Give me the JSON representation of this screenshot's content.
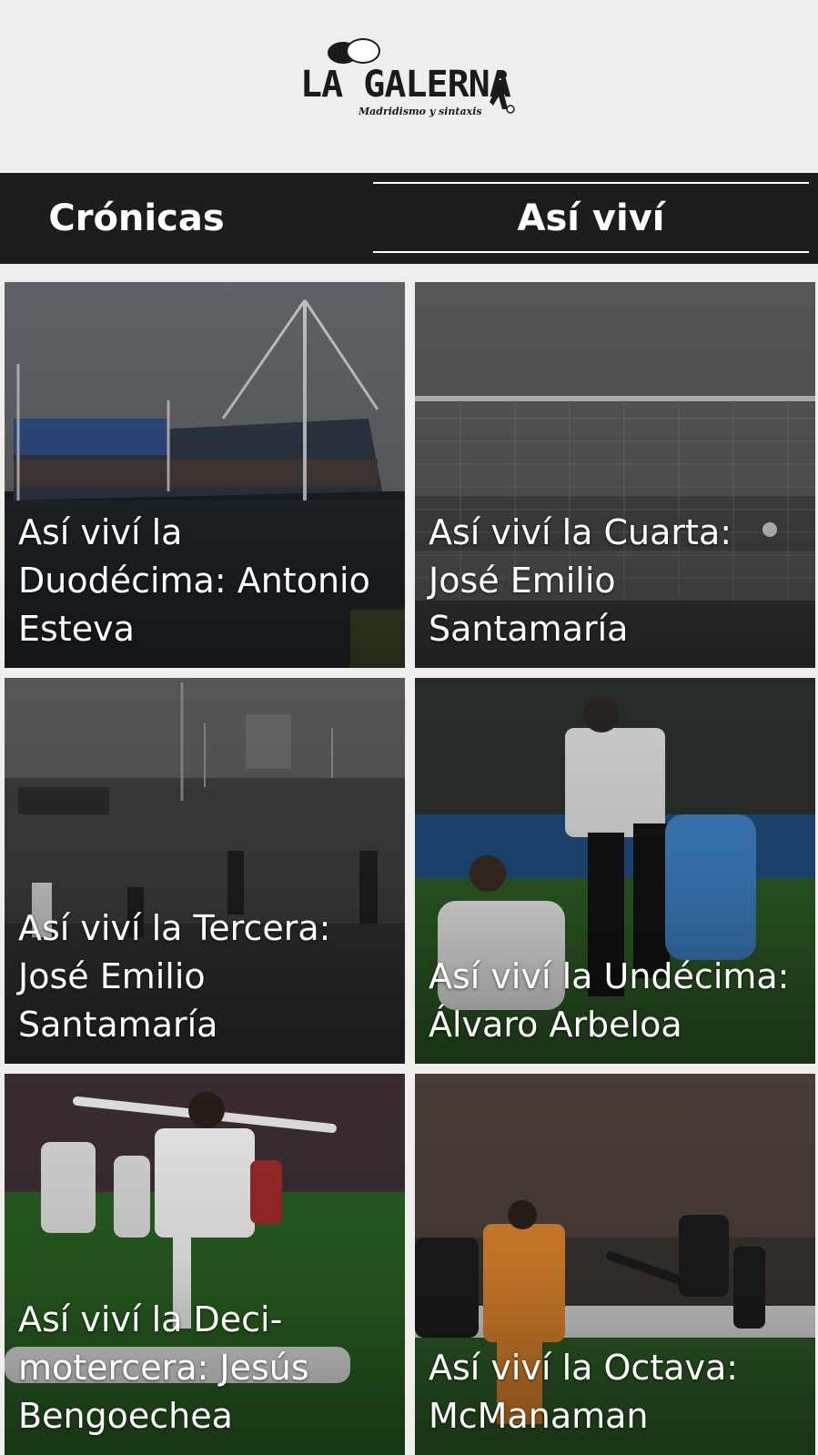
{
  "header": {
    "logo_name": "LA GALERNA",
    "logo_tagline": "Madridismo y sintaxis"
  },
  "tabs": [
    {
      "label": "Crónicas",
      "selected": false
    },
    {
      "label": "Así viví",
      "selected": true
    }
  ],
  "articles": [
    {
      "title": "Así viví la Duodécima: Antonio Esteva"
    },
    {
      "title": "Así viví la Cuarta: José Emilio Santamaría"
    },
    {
      "title": "Así viví la Tercera: José Emilio Santamaría"
    },
    {
      "title": "Así viví la Undécima: Álvaro Arbeloa"
    },
    {
      "title": "Así viví la Deci-motercera: Jesús Bengoechea"
    },
    {
      "title": "Así viví la Octava: McManaman"
    }
  ],
  "colors": {
    "tab_bar_bg": "#1d1d1d",
    "page_bg": "#efeeec",
    "text_on_dark": "#ffffff"
  }
}
